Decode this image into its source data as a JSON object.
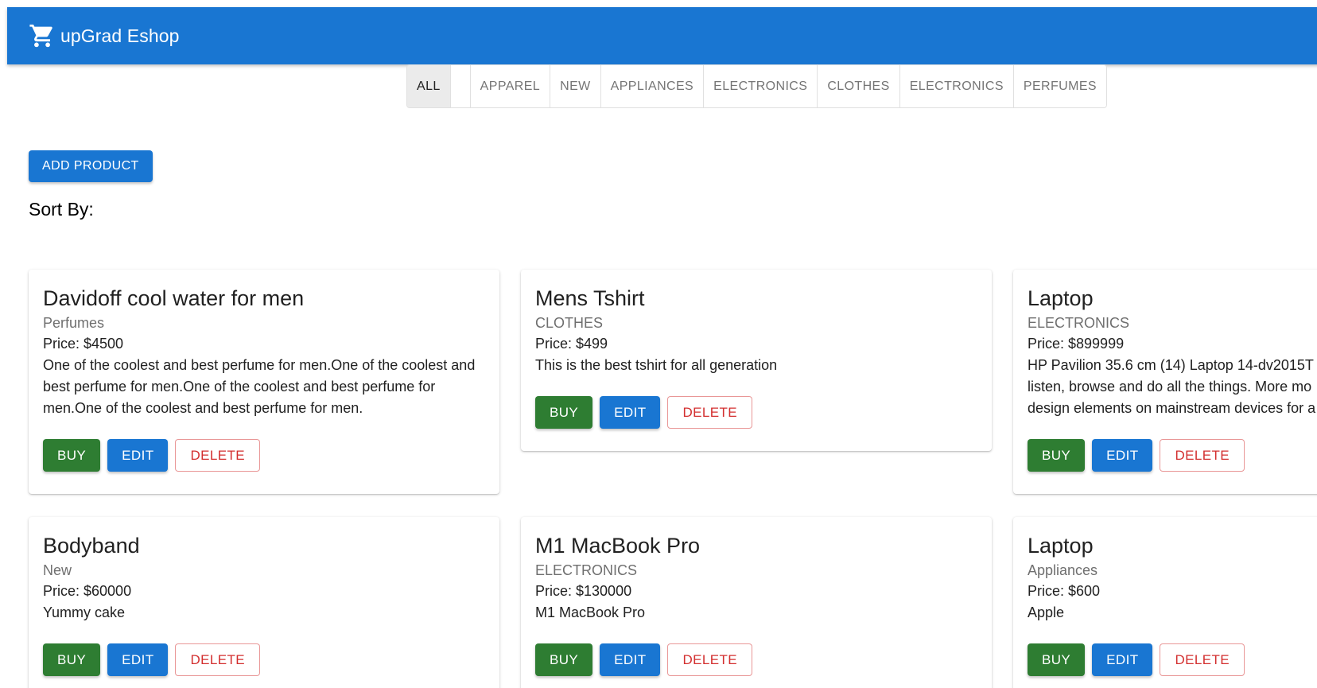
{
  "appbar": {
    "brand": "upGrad Eshop",
    "icon": "shopping-cart-icon"
  },
  "categories": [
    {
      "label": "ALL",
      "selected": true
    },
    {
      "label": "",
      "selected": false
    },
    {
      "label": "APPAREL",
      "selected": false
    },
    {
      "label": "NEW",
      "selected": false
    },
    {
      "label": "APPLIANCES",
      "selected": false
    },
    {
      "label": "ELECTRONICS",
      "selected": false
    },
    {
      "label": "CLOTHES",
      "selected": false
    },
    {
      "label": "ELECTRONICS",
      "selected": false
    },
    {
      "label": "PERFUMES",
      "selected": false
    }
  ],
  "add_product_label": "ADD PRODUCT",
  "sort_label": "Sort By:",
  "buttons": {
    "buy": "BUY",
    "edit": "EDIT",
    "delete": "DELETE"
  },
  "products": [
    {
      "name": "Davidoff cool water for men",
      "category": "Perfumes",
      "price": "Price: $4500",
      "description": "One of the coolest and best perfume for men.One of the coolest and best perfume for men.One of the coolest and best perfume for men.One of the coolest and best perfume for men."
    },
    {
      "name": "Mens Tshirt",
      "category": "CLOTHES",
      "price": "Price: $499",
      "description": "This is the best tshirt for all generation"
    },
    {
      "name": "Laptop",
      "category": "ELECTRONICS",
      "price": "Price: $899999",
      "description_lines": [
        "HP Pavilion 35.6 cm (14) Laptop 14-dv2015T",
        "listen, browse and do all the things. More mo",
        "design elements on mainstream devices for a"
      ]
    },
    {
      "name": "Bodyband",
      "category": "New",
      "price": "Price: $60000",
      "description": "Yummy cake"
    },
    {
      "name": "M1 MacBook Pro",
      "category": "ELECTRONICS",
      "price": "Price: $130000",
      "description": "M1 MacBook Pro"
    },
    {
      "name": "Laptop",
      "category": "Appliances",
      "price": "Price: $600",
      "description": "Apple"
    }
  ],
  "colors": {
    "primary": "#1976d2",
    "success": "#2e7d32",
    "error": "#d32f2f"
  }
}
